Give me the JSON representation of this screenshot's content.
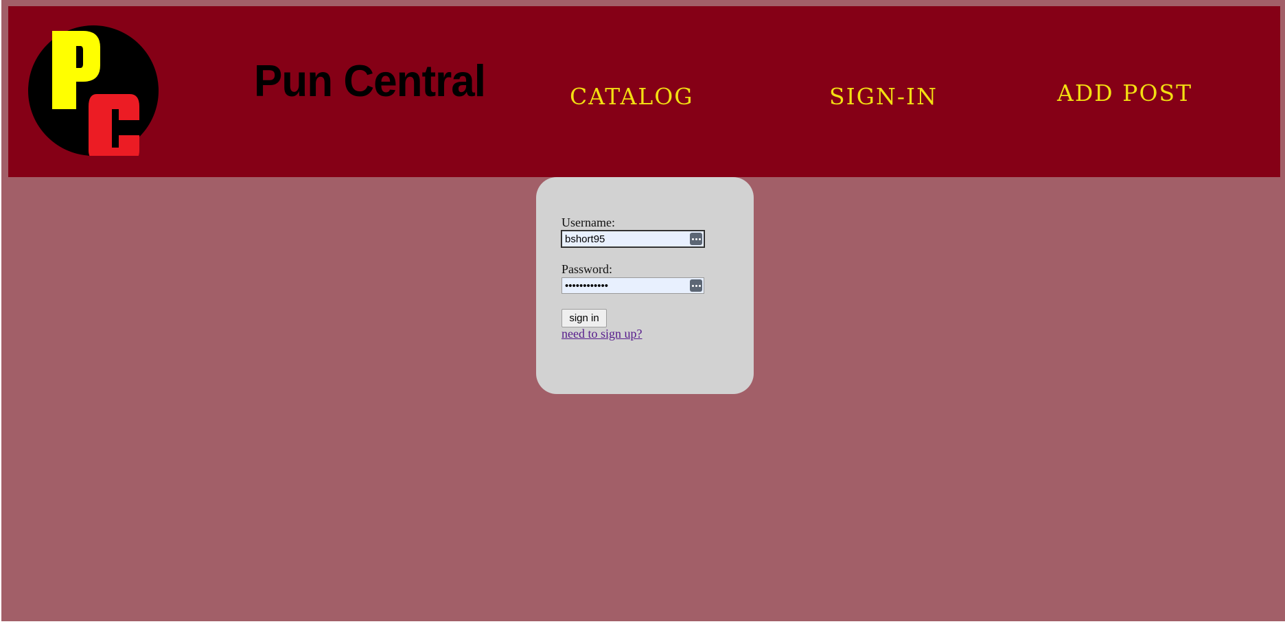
{
  "header": {
    "logo": {
      "letters": [
        "P",
        "C"
      ],
      "colors": {
        "circle": "#000000",
        "p": "#ffff00",
        "c": "#ec1c24"
      }
    },
    "site_title": "Pun Central",
    "nav": [
      {
        "label": "Catalog"
      },
      {
        "label": "Sign-In"
      },
      {
        "label": "Add Post"
      }
    ]
  },
  "signin_form": {
    "username_label": "Username:",
    "username_value": "bshort95",
    "password_label": "Password:",
    "password_value": "bshort95pass",
    "submit_label": "sign in",
    "signup_link": "need to sign up?",
    "field_icon": "password-manager-icon"
  },
  "colors": {
    "page_background": "#a25f68",
    "header_background": "#850016",
    "nav_text": "#f3df12",
    "card_background": "#d2d2d2",
    "link_visited": "#551a8b"
  }
}
